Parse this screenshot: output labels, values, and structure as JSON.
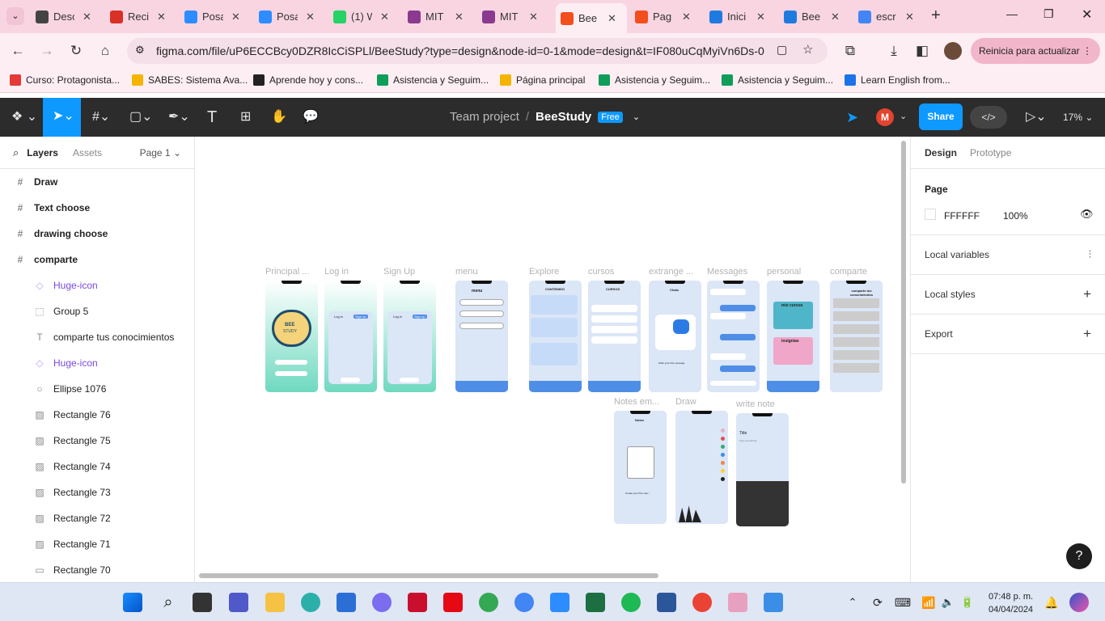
{
  "browser": {
    "tabs": [
      {
        "label": "Desc",
        "icon": "download-icon",
        "color": "#444"
      },
      {
        "label": "Reci",
        "icon": "gmail-icon",
        "color": "#d93025"
      },
      {
        "label": "Posa",
        "icon": "zoom-icon",
        "color": "#2d8cff"
      },
      {
        "label": "Posa",
        "icon": "zoom-icon",
        "color": "#2d8cff"
      },
      {
        "label": "(1) W",
        "icon": "whatsapp-icon",
        "color": "#25d366"
      },
      {
        "label": "MIT",
        "icon": "mit-app-icon",
        "color": "#8b3a8f"
      },
      {
        "label": "MIT",
        "icon": "mit-app-icon",
        "color": "#8b3a8f"
      },
      {
        "label": "Bee",
        "icon": "figma-icon",
        "color": "#f24e1e",
        "active": true
      },
      {
        "label": "Pag",
        "icon": "figma-icon",
        "color": "#f24e1e"
      },
      {
        "label": "Inici",
        "icon": "canva-icon",
        "color": "#1f7ae0"
      },
      {
        "label": "Bee",
        "icon": "canva-icon",
        "color": "#1f7ae0"
      },
      {
        "label": "escr",
        "icon": "google-icon",
        "color": "#4285f4"
      }
    ],
    "url": "figma.com/file/uP6ECCBcy0DZR8IcCiSPLl/BeeStudy?type=design&node-id=0-1&mode=design&t=IF080uCqMyiVn6Ds-0",
    "relaunch_label": "Reinicia para actualizar",
    "bookmarks": [
      {
        "label": "Curso: Protagonista...",
        "color": "#e53935"
      },
      {
        "label": "SABES: Sistema Ava...",
        "color": "#f4b400"
      },
      {
        "label": "Aprende hoy y cons...",
        "color": "#222"
      },
      {
        "label": "Asistencia y Seguim...",
        "color": "#0f9d58"
      },
      {
        "label": "Página principal",
        "color": "#f4b400"
      },
      {
        "label": "Asistencia y Seguim...",
        "color": "#0f9d58"
      },
      {
        "label": "Asistencia y Seguim...",
        "color": "#0f9d58"
      },
      {
        "label": "Learn English from...",
        "color": "#1a73e8"
      }
    ]
  },
  "figma": {
    "team": "Team project",
    "separator": "/",
    "file": "BeeStudy",
    "plan_badge": "Free",
    "avatar_initial": "M",
    "share_label": "Share",
    "zoom": "17%"
  },
  "layers_panel": {
    "tab_layers": "Layers",
    "tab_assets": "Assets",
    "page_selector": "Page 1",
    "items": [
      {
        "label": "Draw",
        "icon": "#",
        "indent": 0,
        "bold": true
      },
      {
        "label": "Text choose",
        "icon": "#",
        "indent": 0,
        "bold": true
      },
      {
        "label": "drawing choose",
        "icon": "#",
        "indent": 0,
        "bold": true
      },
      {
        "label": "comparte",
        "icon": "#",
        "indent": 0,
        "bold": true
      },
      {
        "label": "Huge-icon",
        "icon": "◇",
        "indent": 1,
        "purple": true
      },
      {
        "label": "Group 5",
        "icon": "⬚",
        "indent": 1
      },
      {
        "label": "comparte tus conocimientos",
        "icon": "T",
        "indent": 1
      },
      {
        "label": "Huge-icon",
        "icon": "◇",
        "indent": 1,
        "purple": true
      },
      {
        "label": "Ellipse 1076",
        "icon": "○",
        "indent": 1
      },
      {
        "label": "Rectangle 76",
        "icon": "▨",
        "indent": 1
      },
      {
        "label": "Rectangle 75",
        "icon": "▨",
        "indent": 1
      },
      {
        "label": "Rectangle 74",
        "icon": "▨",
        "indent": 1
      },
      {
        "label": "Rectangle 73",
        "icon": "▨",
        "indent": 1
      },
      {
        "label": "Rectangle 72",
        "icon": "▨",
        "indent": 1
      },
      {
        "label": "Rectangle 71",
        "icon": "▨",
        "indent": 1
      },
      {
        "label": "Rectangle 70",
        "icon": "▭",
        "indent": 1
      }
    ]
  },
  "canvas": {
    "frames": [
      {
        "label": "Principal ...",
        "style": "gradient",
        "caption1": "BEE",
        "caption2": "STUDY"
      },
      {
        "label": "Log in",
        "style": "login",
        "caption1": "Log in",
        "caption2": "Sign up"
      },
      {
        "label": "Sign Up",
        "style": "login",
        "caption1": "Log in",
        "caption2": "Sign up"
      },
      {
        "label": "menu",
        "style": "menu",
        "caption1": "menu"
      },
      {
        "label": "Explore",
        "style": "explore",
        "caption1": "CONTENIDO"
      },
      {
        "label": "cursos",
        "style": "cursos",
        "caption1": "CURSOS"
      },
      {
        "label": "extrange ...",
        "style": "chat",
        "caption1": "Chats",
        "caption2": "Write your first message"
      },
      {
        "label": "Messages",
        "style": "messages"
      },
      {
        "label": "personal",
        "style": "personal",
        "caption1": "mis cursos",
        "caption2": "insignias"
      },
      {
        "label": "comparte",
        "style": "comparte",
        "caption1": "comparte tus conocimientos"
      },
      {
        "label": "Notes em...",
        "style": "notes",
        "caption1": "Notes",
        "caption2": "Create your first note !"
      },
      {
        "label": "Draw",
        "style": "draw"
      },
      {
        "label": "write note",
        "style": "write",
        "caption1": "Title",
        "caption2": "Type something..."
      }
    ]
  },
  "right_panel": {
    "tab_design": "Design",
    "tab_prototype": "Prototype",
    "page_title": "Page",
    "page_color": "FFFFFF",
    "page_opacity": "100%",
    "local_variables": "Local variables",
    "local_styles": "Local styles",
    "export": "Export",
    "help": "?"
  },
  "taskbar": {
    "time": "07:48 p. m.",
    "date": "04/04/2024"
  }
}
